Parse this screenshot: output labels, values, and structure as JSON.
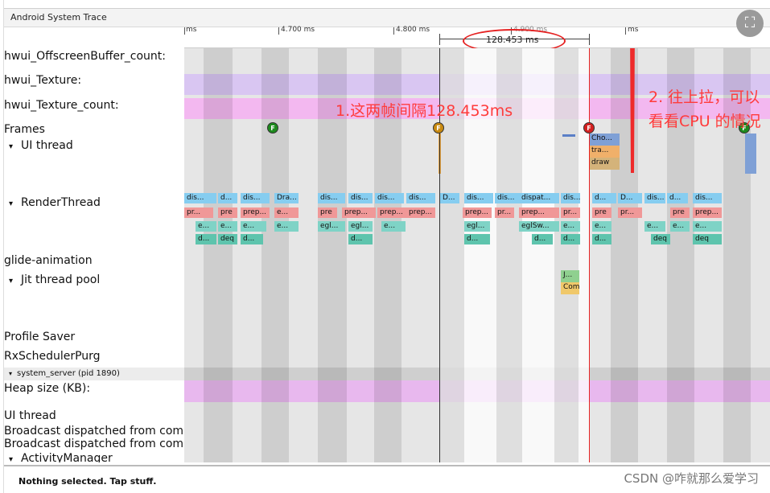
{
  "window": {
    "title": "Android System Trace"
  },
  "ruler": {
    "ticks": [
      "ms",
      "4.700 ms",
      "4.800 ms",
      "4.900 ms",
      "ms"
    ],
    "selection_label": "128.453 ms"
  },
  "tracks": {
    "hwui_offscreen": "hwui_OffscreenBuffer_count:",
    "hwui_texture": "hwui_Texture:",
    "hwui_texture_count": "hwui_Texture_count:",
    "frames": "Frames",
    "ui_thread": "UI thread",
    "render_thread": "RenderThread",
    "glide": "glide-animation",
    "jit": "Jit thread pool",
    "profile_saver": "Profile Saver",
    "rx_scheduler": "RxSchedulerPurg",
    "system_server": "system_server (pid 1890)",
    "heap_size": "Heap size (KB):",
    "ui_thread_2": "UI thread",
    "broadcast_1": "Broadcast dispatched from com",
    "broadcast_2": "Broadcast dispatched from com",
    "activity_manager": "ActivityManager"
  },
  "frame_marker_letter": "F",
  "ui_slices": [
    "Cho...",
    "tra...",
    "draw"
  ],
  "render_slices": {
    "row1": [
      "dis...",
      "d...",
      "dis...",
      "Dra...",
      "dis...",
      "dis...",
      "dis...",
      "dis...",
      "D...",
      "dis...",
      "dis...",
      "dispat...",
      "dis...",
      "d...",
      "D...",
      "dis...",
      "d...",
      "dis..."
    ],
    "row2": [
      "pr...",
      "pre",
      "prep...",
      "e...",
      "pre",
      "prep...",
      "prep...",
      "prep...",
      "prep...",
      "pr...",
      "prep...",
      "pr...",
      "pre",
      "pr...",
      "pre",
      "prep..."
    ],
    "row3": [
      "e...",
      "e...",
      "e...",
      "e...",
      "egl...",
      "egl...",
      "e...",
      "egl...",
      "eglSw...",
      "e...",
      "e...",
      "e...",
      "e...",
      "e..."
    ],
    "row4": [
      "d...",
      "deq",
      "d...",
      "d...",
      "d...",
      "d...",
      "d...",
      "d...",
      "deq",
      "deq",
      "deq..."
    ]
  },
  "jit_slices": [
    "J...",
    "Com"
  ],
  "annotations": {
    "interval_note": "1.这两帧间隔128.453ms",
    "scroll_note": "2. 往上拉，可以看看CPU 的情况"
  },
  "status": {
    "text": "Nothing selected. Tap stuff."
  },
  "watermark": "CSDN @咋就那么爱学习",
  "colors": {
    "texture_band": "#d9c6f2",
    "texture_count_band": "#f3b8f0",
    "heap_band": "#e8b8ee",
    "annotation_red": "#ff3b3b",
    "marker_green": "#1d8a1d",
    "marker_orange": "#c98a10",
    "marker_red": "#d42020"
  },
  "icons": {
    "expand": "expand-icon"
  }
}
